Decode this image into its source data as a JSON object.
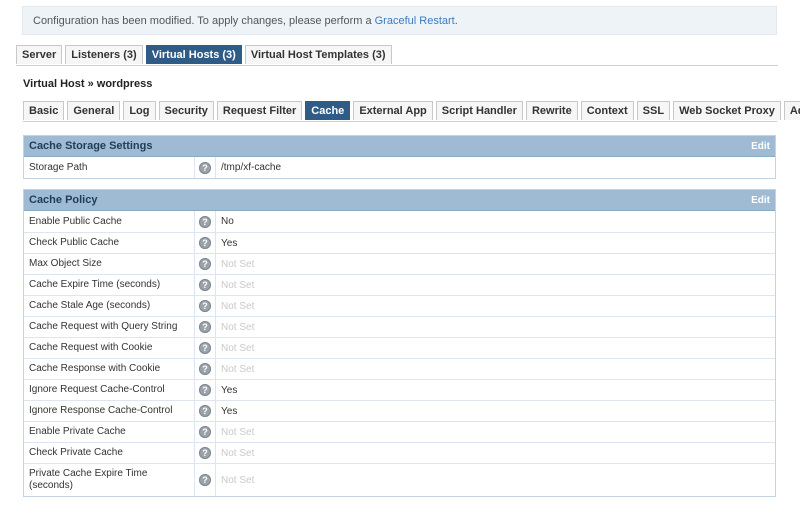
{
  "notice": {
    "text": "Configuration has been modified. To apply changes, please perform a ",
    "link": "Graceful Restart",
    "end": "."
  },
  "main_tabs": [
    "Server",
    "Listeners (3)",
    "Virtual Hosts (3)",
    "Virtual Host Templates (3)"
  ],
  "main_tab_active": "Virtual Hosts (3)",
  "vhost_title": "Virtual Host » wordpress",
  "sub_tabs": [
    "Basic",
    "General",
    "Log",
    "Security",
    "Request Filter",
    "Cache",
    "External App",
    "Script Handler",
    "Rewrite",
    "Context",
    "SSL",
    "Web Socket Proxy",
    "Add-ons"
  ],
  "sub_tab_active": "Cache",
  "storage": {
    "title": "Cache Storage Settings",
    "edit_label": "Edit",
    "rows": [
      {
        "label": "Storage Path",
        "value": "/tmp/xf-cache",
        "set": true
      }
    ]
  },
  "policy": {
    "title": "Cache Policy",
    "edit_label": "Edit",
    "rows": [
      {
        "label": "Enable Public Cache",
        "value": "No",
        "set": true
      },
      {
        "label": "Check Public Cache",
        "value": "Yes",
        "set": true
      },
      {
        "label": "Max Object Size",
        "value": "Not Set",
        "set": false
      },
      {
        "label": "Cache Expire Time (seconds)",
        "value": "Not Set",
        "set": false
      },
      {
        "label": "Cache Stale Age (seconds)",
        "value": "Not Set",
        "set": false
      },
      {
        "label": "Cache Request with Query String",
        "value": "Not Set",
        "set": false
      },
      {
        "label": "Cache Request with Cookie",
        "value": "Not Set",
        "set": false
      },
      {
        "label": "Cache Response with Cookie",
        "value": "Not Set",
        "set": false
      },
      {
        "label": "Ignore Request Cache-Control",
        "value": "Yes",
        "set": true
      },
      {
        "label": "Ignore Response Cache-Control",
        "value": "Yes",
        "set": true
      },
      {
        "label": "Enable Private Cache",
        "value": "Not Set",
        "set": false
      },
      {
        "label": "Check Private Cache",
        "value": "Not Set",
        "set": false
      },
      {
        "label": "Private Cache Expire Time (seconds)",
        "value": "Not Set",
        "set": false
      }
    ]
  },
  "help_icon": "question-circle-icon"
}
